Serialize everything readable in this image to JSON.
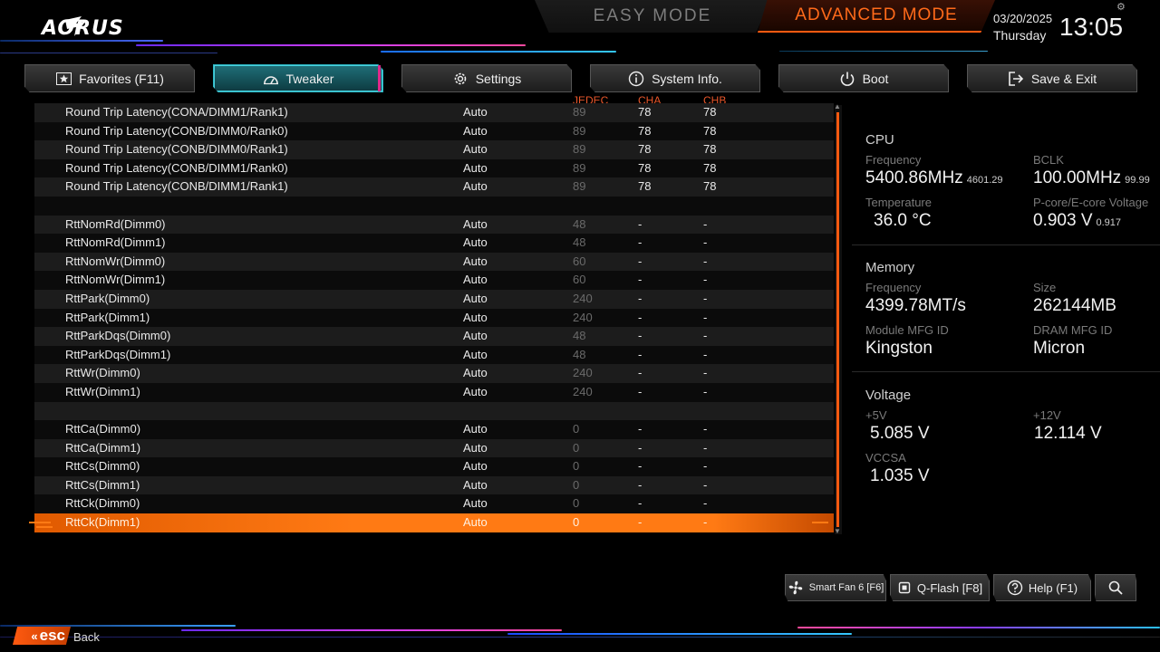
{
  "header": {
    "brand": "AORUS",
    "easy_mode": "EASY MODE",
    "advanced_mode": "ADVANCED MODE",
    "date": "03/20/2025",
    "day": "Thursday",
    "time": "13:05"
  },
  "tabs": [
    {
      "label": "Favorites (F11)",
      "icon": "star-icon"
    },
    {
      "label": "Tweaker",
      "icon": "speedometer-icon"
    },
    {
      "label": "Settings",
      "icon": "gear-icon"
    },
    {
      "label": "System Info.",
      "icon": "info-icon"
    },
    {
      "label": "Boot",
      "icon": "power-icon"
    },
    {
      "label": "Save & Exit",
      "icon": "exit-icon"
    }
  ],
  "columns": {
    "jedec": "JEDEC",
    "cha": "CHA",
    "chb": "CHB"
  },
  "rows": [
    {
      "name": "Round Trip Latency(CONA/DIMM1/Rank1)",
      "value": "Auto",
      "jedec": "89",
      "cha": "78",
      "chb": "78"
    },
    {
      "name": "Round Trip Latency(CONB/DIMM0/Rank0)",
      "value": "Auto",
      "jedec": "89",
      "cha": "78",
      "chb": "78"
    },
    {
      "name": "Round Trip Latency(CONB/DIMM0/Rank1)",
      "value": "Auto",
      "jedec": "89",
      "cha": "78",
      "chb": "78"
    },
    {
      "name": "Round Trip Latency(CONB/DIMM1/Rank0)",
      "value": "Auto",
      "jedec": "89",
      "cha": "78",
      "chb": "78"
    },
    {
      "name": "Round Trip Latency(CONB/DIMM1/Rank1)",
      "value": "Auto",
      "jedec": "89",
      "cha": "78",
      "chb": "78"
    },
    {
      "name": "",
      "value": "",
      "jedec": "",
      "cha": "",
      "chb": ""
    },
    {
      "name": "RttNomRd(Dimm0)",
      "value": "Auto",
      "jedec": "48",
      "cha": "-",
      "chb": "-"
    },
    {
      "name": "RttNomRd(Dimm1)",
      "value": "Auto",
      "jedec": "48",
      "cha": "-",
      "chb": "-"
    },
    {
      "name": "RttNomWr(Dimm0)",
      "value": "Auto",
      "jedec": "60",
      "cha": "-",
      "chb": "-"
    },
    {
      "name": "RttNomWr(Dimm1)",
      "value": "Auto",
      "jedec": "60",
      "cha": "-",
      "chb": "-"
    },
    {
      "name": "RttPark(Dimm0)",
      "value": "Auto",
      "jedec": "240",
      "cha": "-",
      "chb": "-"
    },
    {
      "name": "RttPark(Dimm1)",
      "value": "Auto",
      "jedec": "240",
      "cha": "-",
      "chb": "-"
    },
    {
      "name": "RttParkDqs(Dimm0)",
      "value": "Auto",
      "jedec": "48",
      "cha": "-",
      "chb": "-"
    },
    {
      "name": "RttParkDqs(Dimm1)",
      "value": "Auto",
      "jedec": "48",
      "cha": "-",
      "chb": "-"
    },
    {
      "name": "RttWr(Dimm0)",
      "value": "Auto",
      "jedec": "240",
      "cha": "-",
      "chb": "-"
    },
    {
      "name": "RttWr(Dimm1)",
      "value": "Auto",
      "jedec": "240",
      "cha": "-",
      "chb": "-"
    },
    {
      "name": "",
      "value": "",
      "jedec": "",
      "cha": "",
      "chb": ""
    },
    {
      "name": "RttCa(Dimm0)",
      "value": "Auto",
      "jedec": "0",
      "cha": "-",
      "chb": "-"
    },
    {
      "name": "RttCa(Dimm1)",
      "value": "Auto",
      "jedec": "0",
      "cha": "-",
      "chb": "-"
    },
    {
      "name": "RttCs(Dimm0)",
      "value": "Auto",
      "jedec": "0",
      "cha": "-",
      "chb": "-"
    },
    {
      "name": "RttCs(Dimm1)",
      "value": "Auto",
      "jedec": "0",
      "cha": "-",
      "chb": "-"
    },
    {
      "name": "RttCk(Dimm0)",
      "value": "Auto",
      "jedec": "0",
      "cha": "-",
      "chb": "-"
    },
    {
      "name": "RttCk(Dimm1)",
      "value": "Auto",
      "jedec": "0",
      "cha": "-",
      "chb": "-",
      "selected": true
    }
  ],
  "panel": {
    "cpu": {
      "title": "CPU",
      "freq_label": "Frequency",
      "freq": "5400.86MHz",
      "freq_sub": "4601.29",
      "bclk_label": "BCLK",
      "bclk": "100.00MHz",
      "bclk_sub": "99.99",
      "temp_label": "Temperature",
      "temp": "36.0 °C",
      "volt_label": "P-core/E-core Voltage",
      "volt": "0.903 V",
      "volt_sub": "0.917"
    },
    "memory": {
      "title": "Memory",
      "freq_label": "Frequency",
      "freq": "4399.78MT/s",
      "size_label": "Size",
      "size": "262144MB",
      "module_label": "Module MFG ID",
      "module": "Kingston",
      "dram_label": "DRAM MFG ID",
      "dram": "Micron"
    },
    "voltage": {
      "title": "Voltage",
      "v5_label": "+5V",
      "v5": "5.085 V",
      "v12_label": "+12V",
      "v12": "12.114 V",
      "vccsa_label": "VCCSA",
      "vccsa": "1.035 V"
    }
  },
  "bottom": {
    "smart_fan": "Smart Fan 6 [F6]",
    "qflash": "Q-Flash [F8]",
    "help": "Help (F1)",
    "esc": "esc",
    "back": "Back"
  },
  "colors": {
    "accent_orange": "#ff6a1a",
    "accent_teal": "#2fb6c4",
    "accent_pink": "#e0288a"
  }
}
